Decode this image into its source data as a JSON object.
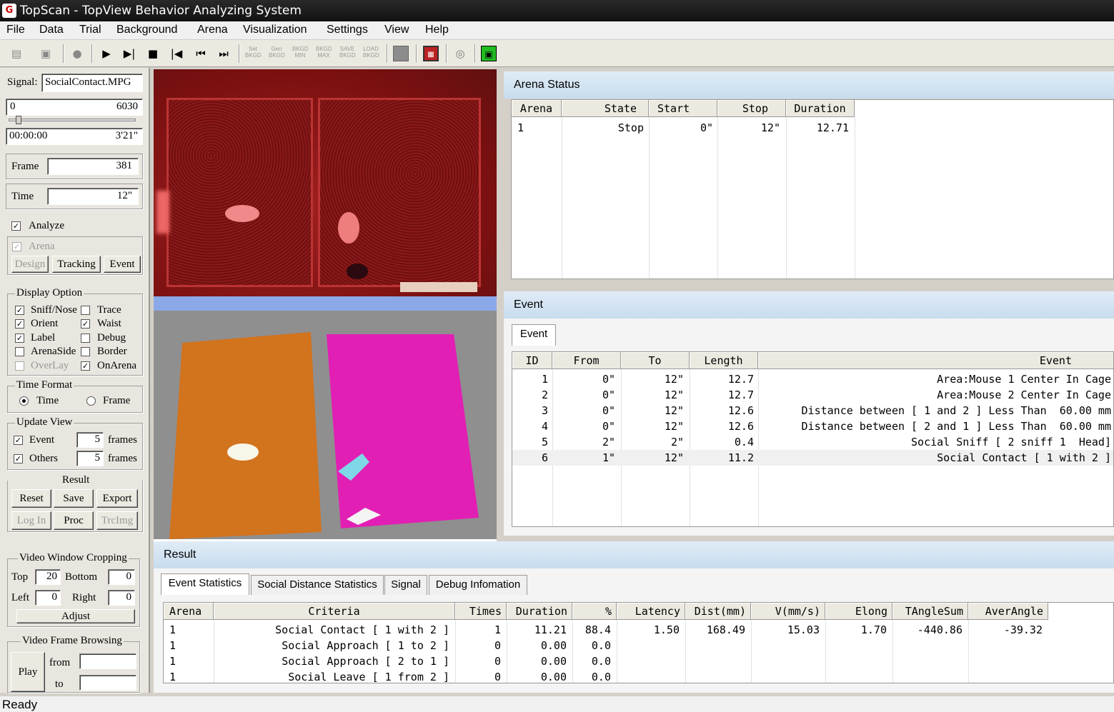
{
  "window": {
    "title": "TopScan - TopView Behavior Analyzing System"
  },
  "menu": [
    "File",
    "Data",
    "Trial",
    "Background",
    "Arena",
    "Visualization",
    "Settings",
    "View",
    "Help"
  ],
  "toolbar": {
    "set_bkgd": "Set BKGD",
    "gen_bkgd": "Gen BKGD",
    "bkgd_min": "BKGD MIN",
    "bkgd_max": "BKGD MAX",
    "save_bkgd": "SAVE BKGD",
    "load_bkgd": "LOAD BKGD"
  },
  "left": {
    "signal_label": "Signal:",
    "signal_value": "SocialContact.MPG",
    "range_start": "0",
    "range_end": "6030",
    "slider_fraction": 0.05,
    "time_start": "00:00:00",
    "time_end": "3'21\"",
    "frame_label": "Frame",
    "frame_value": "381",
    "time_label": "Time",
    "time_value": "12\"",
    "analyze_label": "Analyze",
    "analyze_checked": true,
    "arena_label": "Arena",
    "arena_checked": true,
    "design_btn": "Design",
    "tracking_btn": "Tracking",
    "event_btn": "Event",
    "display_option": {
      "title": "Display Option",
      "items": [
        {
          "label": "Sniff/Nose",
          "checked": true
        },
        {
          "label": "Trace",
          "checked": false
        },
        {
          "label": "Orient",
          "checked": true
        },
        {
          "label": "Waist",
          "checked": true
        },
        {
          "label": "Label",
          "checked": true
        },
        {
          "label": "Debug",
          "checked": false
        },
        {
          "label": "ArenaSide",
          "checked": false
        },
        {
          "label": "Border",
          "checked": false
        },
        {
          "label": "OverLay",
          "checked": false
        },
        {
          "label": "OnArena",
          "checked": true
        }
      ]
    },
    "time_format": {
      "title": "Time Format",
      "time": "Time",
      "frame": "Frame",
      "selected": "Time"
    },
    "update_view": {
      "title": "Update View",
      "event_label": "Event",
      "event_value": "5",
      "others_label": "Others",
      "others_value": "5",
      "unit": "frames"
    },
    "result": {
      "title": "Result",
      "reset": "Reset",
      "save": "Save",
      "export": "Export",
      "login": "Log In",
      "proc": "Proc",
      "trcimg": "TrcImg"
    },
    "cropping": {
      "title": "Video Window Cropping",
      "top_label": "Top",
      "top_value": "20",
      "bottom_label": "Bottom",
      "bottom_value": "0",
      "left_label": "Left",
      "left_value": "0",
      "right_label": "Right",
      "right_value": "0",
      "adjust": "Adjust"
    },
    "browsing": {
      "title": "Video Frame Browsing",
      "play": "Play",
      "from": "from",
      "to": "to"
    }
  },
  "colors": {
    "arena_left": "#d2731e",
    "arena_right": "#e21fb4",
    "video_red": "#8a1414"
  },
  "arena_status": {
    "title": "Arena Status",
    "columns": [
      "Arena",
      "State",
      "Start",
      "Stop",
      "Duration"
    ],
    "rows": [
      [
        "1",
        "Stop",
        "0\"",
        "12\"",
        "12.71"
      ]
    ]
  },
  "event_panel": {
    "title": "Event",
    "tab": "Event",
    "columns": [
      "ID",
      "From",
      "To",
      "Length",
      "Event"
    ],
    "rows": [
      [
        "1",
        "0\"",
        "12\"",
        "12.7",
        "Area:Mouse 1 Center In Cage"
      ],
      [
        "2",
        "0\"",
        "12\"",
        "12.7",
        "Area:Mouse 2 Center In Cage"
      ],
      [
        "3",
        "0\"",
        "12\"",
        "12.6",
        "Distance between [ 1 and 2 ] Less Than  60.00 mm"
      ],
      [
        "4",
        "0\"",
        "12\"",
        "12.6",
        "Distance between [ 2 and 1 ] Less Than  60.00 mm"
      ],
      [
        "5",
        "2\"",
        "2\"",
        "0.4",
        "Social Sniff [ 2 sniff 1  Head]"
      ],
      [
        "6",
        "1\"",
        "12\"",
        "11.2",
        "Social Contact [ 1 with 2 ]"
      ]
    ]
  },
  "result_panel": {
    "title": "Result",
    "tabs": [
      "Event Statistics",
      "Social Distance Statistics",
      "Signal",
      "Debug Infomation"
    ],
    "columns": [
      "Arena",
      "Criteria",
      "Times",
      "Duration",
      "%",
      "Latency",
      "Dist(mm)",
      "V(mm/s)",
      "Elong",
      "TAngleSum",
      "AverAngle"
    ],
    "rows": [
      [
        "1",
        "Social Contact [ 1 with 2 ]",
        "1",
        "11.21",
        "88.4",
        "1.50",
        "168.49",
        "15.03",
        "1.70",
        "-440.86",
        "-39.32"
      ],
      [
        "1",
        "Social Approach [ 1 to 2 ]",
        "0",
        "0.00",
        "0.0",
        "",
        "",
        "",
        "",
        "",
        ""
      ],
      [
        "1",
        "Social Approach [ 2 to 1 ]",
        "0",
        "0.00",
        "0.0",
        "",
        "",
        "",
        "",
        "",
        ""
      ],
      [
        "1",
        "Social Leave [ 1 from 2 ]",
        "0",
        "0.00",
        "0.0",
        "",
        "",
        "",
        "",
        "",
        ""
      ]
    ]
  },
  "status": "Ready"
}
